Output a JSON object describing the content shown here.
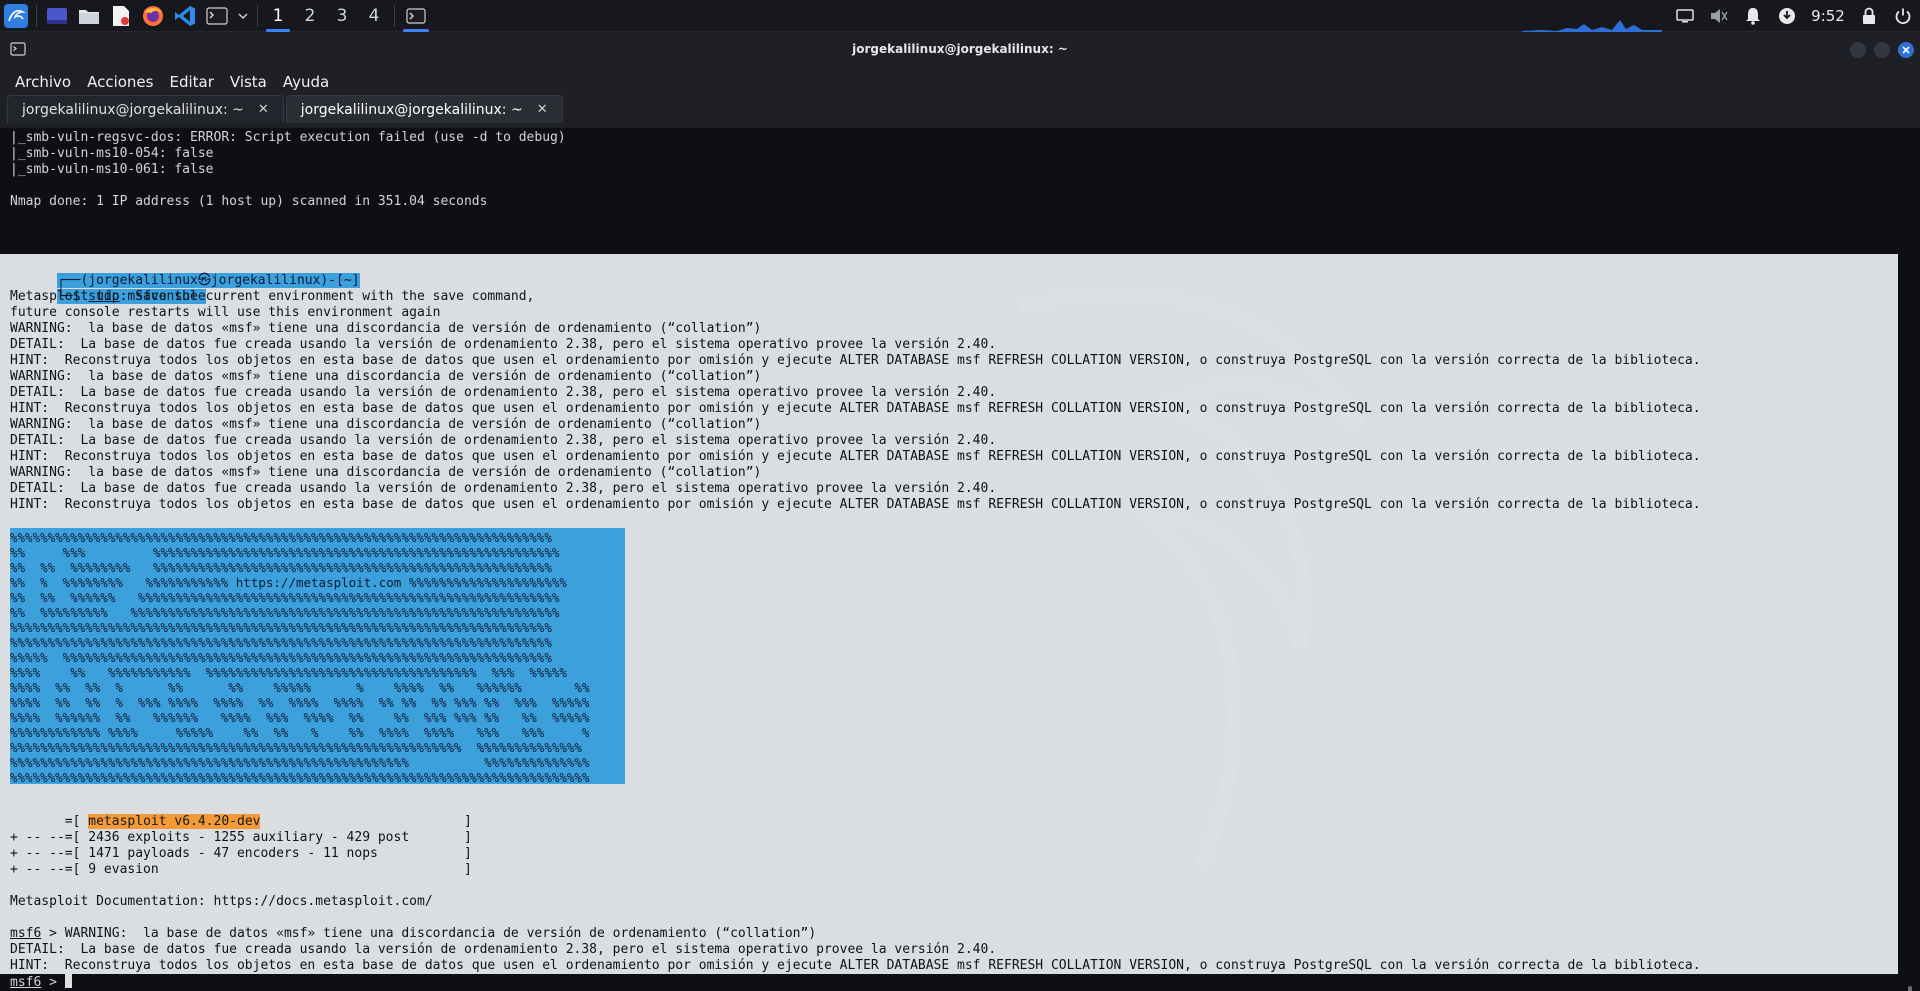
{
  "panel": {
    "workspaces": [
      "1",
      "2",
      "3",
      "4"
    ],
    "active_workspace": "1",
    "clock": "9:52"
  },
  "window": {
    "title": "jorgekalilinux@jorgekalilinux: ~"
  },
  "menu": [
    "Archivo",
    "Acciones",
    "Editar",
    "Vista",
    "Ayuda"
  ],
  "tabs": [
    {
      "label": "jorgekalilinux@jorgekalilinux: ~",
      "close": "✕"
    },
    {
      "label": "jorgekalilinux@jorgekalilinux: ~",
      "close": "✕"
    }
  ],
  "terminal": {
    "pre_lines": [
      "|_smb-vuln-regsvc-dos: ERROR: Script execution failed (use -d to debug)",
      "|_smb-vuln-ms10-054: false",
      "|_smb-vuln-ms10-061: false",
      "",
      "Nmap done: 1 IP address (1 host up) scanned in 351.04 seconds"
    ],
    "prompt_user": "┌──(jorgekalilinux㉿jorgekalilinux)-[~]",
    "prompt_cmd_prefix": "└─$ ",
    "prompt_cmd_sudo": "sudo",
    "prompt_cmd_rest": " msfconsole",
    "output_lines": [
      "Metasploit tip: Save the current environment with the save command,",
      "future console restarts will use this environment again",
      "WARNING:  la base de datos «msf» tiene una discordancia de versión de ordenamiento (“collation”)",
      "DETAIL:  La base de datos fue creada usando la versión de ordenamiento 2.38, pero el sistema operativo provee la versión 2.40.",
      "HINT:  Reconstruya todos los objetos en esta base de datos que usen el ordenamiento por omisión y ejecute ALTER DATABASE msf REFRESH COLLATION VERSION, o construya PostgreSQL con la versión correcta de la biblioteca.",
      "WARNING:  la base de datos «msf» tiene una discordancia de versión de ordenamiento (“collation”)",
      "DETAIL:  La base de datos fue creada usando la versión de ordenamiento 2.38, pero el sistema operativo provee la versión 2.40.",
      "HINT:  Reconstruya todos los objetos en esta base de datos que usen el ordenamiento por omisión y ejecute ALTER DATABASE msf REFRESH COLLATION VERSION, o construya PostgreSQL con la versión correcta de la biblioteca.",
      "WARNING:  la base de datos «msf» tiene una discordancia de versión de ordenamiento (“collation”)",
      "DETAIL:  La base de datos fue creada usando la versión de ordenamiento 2.38, pero el sistema operativo provee la versión 2.40.",
      "HINT:  Reconstruya todos los objetos en esta base de datos que usen el ordenamiento por omisión y ejecute ALTER DATABASE msf REFRESH COLLATION VERSION, o construya PostgreSQL con la versión correcta de la biblioteca.",
      "WARNING:  la base de datos «msf» tiene una discordancia de versión de ordenamiento (“collation”)",
      "DETAIL:  La base de datos fue creada usando la versión de ordenamiento 2.38, pero el sistema operativo provee la versión 2.40.",
      "HINT:  Reconstruya todos los objetos en esta base de datos que usen el ordenamiento por omisión y ejecute ALTER DATABASE msf REFRESH COLLATION VERSION, o construya PostgreSQL con la versión correcta de la biblioteca."
    ],
    "banner": [
      "%%%%%%%%%%%%%%%%%%%%%%%%%%%%%%%%%%%%%%%%%%%%%%%%%%%%%%%%%%%%%%%%%%%%%%%%",
      "%%     %%%         %%%%%%%%%%%%%%%%%%%%%%%%%%%%%%%%%%%%%%%%%%%%%%%%%%%%%%",
      "%%  %%  %%%%%%%%   %%%%%%%%%%%%%%%%%%%%%%%%%%%%%%%%%%%%%%%%%%%%%%%%%%%%%",
      "%%  %  %%%%%%%%   %%%%%%%%%%% https://metasploit.com %%%%%%%%%%%%%%%%%%%%%",
      "%%  %%  %%%%%%   %%%%%%%%%%%%%%%%%%%%%%%%%%%%%%%%%%%%%%%%%%%%%%%%%%%%%%%%",
      "%%  %%%%%%%%%   %%%%%%%%%%%%%%%%%%%%%%%%%%%%%%%%%%%%%%%%%%%%%%%%%%%%%%%%%",
      "%%%%%%%%%%%%%%%%%%%%%%%%%%%%%%%%%%%%%%%%%%%%%%%%%%%%%%%%%%%%%%%%%%%%%%%%",
      "%%%%%%%%%%%%%%%%%%%%%%%%%%%%%%%%%%%%%%%%%%%%%%%%%%%%%%%%%%%%%%%%%%%%%%%%",
      "%%%%%  %%%%%%%%%%%%%%%%%%%%%%%%%%%%%%%%%%%%%%%%%%%%%%%%%%%%%%%%%%%%%%%%%",
      "%%%%    %%   %%%%%%%%%%%  %%%%%%%%%%%%%%%%%%%%%%%%%%%%%%%%%%%%  %%%  %%%%%",
      "%%%%  %%  %%  %      %%      %%    %%%%%      %    %%%%  %%   %%%%%%       %%",
      "%%%%  %%  %%  %  %%% %%%%  %%%%  %%  %%%%  %%%%  %% %%  %% %%% %%  %%%  %%%%%",
      "%%%%  %%%%%%  %%   %%%%%%   %%%%  %%%  %%%%  %%    %%  %%% %%% %%   %%  %%%%%",
      "%%%%%%%%%%%% %%%%     %%%%%    %%  %%   %    %%  %%%%  %%%%   %%%   %%%     %",
      "%%%%%%%%%%%%%%%%%%%%%%%%%%%%%%%%%%%%%%%%%%%%%%%%%%%%%%%%%%%%  %%%%%%%%%%%%%%",
      "%%%%%%%%%%%%%%%%%%%%%%%%%%%%%%%%%%%%%%%%%%%%%%%%%%%%%          %%%%%%%%%%%%%%",
      "%%%%%%%%%%%%%%%%%%%%%%%%%%%%%%%%%%%%%%%%%%%%%%%%%%%%%%%%%%%%%%%%%%%%%%%%%%%%%"
    ],
    "version_line_prefix": "       =[ ",
    "version": "metasploit v6.4.20-dev",
    "version_line_suffix": "                          ]",
    "stats": [
      "+ -- --=[ 2436 exploits - 1255 auxiliary - 429 post       ]",
      "+ -- --=[ 1471 payloads - 47 encoders - 11 nops           ]",
      "+ -- --=[ 9 evasion                                       ]"
    ],
    "docs": "Metasploit Documentation: https://docs.metasploit.com/",
    "msf_prompt": "msf6",
    "msf_sep": " > ",
    "msf_warning": "WARNING:  la base de datos «msf» tiene una discordancia de versión de ordenamiento (“collation”)",
    "msf_detail": "DETAIL:  La base de datos fue creada usando la versión de ordenamiento 2.38, pero el sistema operativo provee la versión 2.40.",
    "msf_hint": "HINT:  Reconstruya todos los objetos en esta base de datos que usen el ordenamiento por omisión y ejecute ALTER DATABASE msf REFRESH COLLATION VERSION, o construya PostgreSQL con la versión correcta de la biblioteca.",
    "final_prompt": "msf6",
    "final_sep": " > "
  },
  "colors": {
    "accent": "#3b82f6",
    "banner": "#3ba0dc",
    "version_badge": "#f29b38",
    "terminal_bg": "#0d0f13"
  }
}
